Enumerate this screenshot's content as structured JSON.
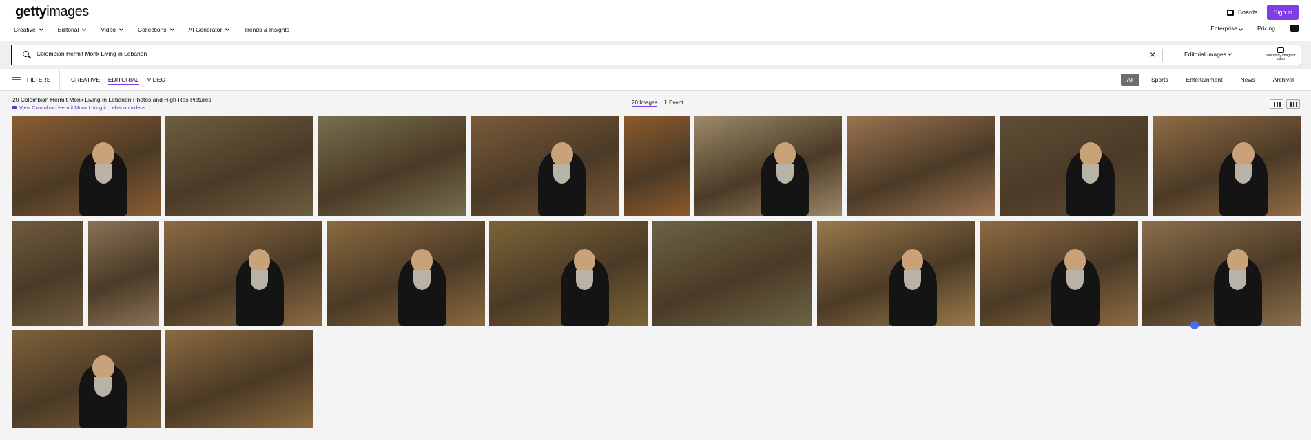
{
  "brand": {
    "logo_bold": "getty",
    "logo_light": "images"
  },
  "header": {
    "boards_label": "Boards",
    "signin_label": "Sign in",
    "nav": [
      {
        "label": "Creative",
        "has_dropdown": true
      },
      {
        "label": "Editorial",
        "has_dropdown": true
      },
      {
        "label": "Video",
        "has_dropdown": true
      },
      {
        "label": "Collections",
        "has_dropdown": true
      },
      {
        "label": "AI Generator",
        "has_dropdown": true
      },
      {
        "label": "Trends & Insights",
        "has_dropdown": false
      }
    ],
    "enterprise_label": "Enterprise",
    "pricing_label": "Pricing"
  },
  "search": {
    "query": "Colombian Hermit Monk Living in Lebanon",
    "type_label": "Editorial Images",
    "search_by_image_label": "Search by image or video"
  },
  "filterbar": {
    "filters_label": "FILTERS",
    "asset_tabs": [
      {
        "label": "CREATIVE",
        "active": false
      },
      {
        "label": "EDITORIAL",
        "active": true
      },
      {
        "label": "VIDEO",
        "active": false
      }
    ],
    "categories": [
      {
        "label": "All",
        "selected": true
      },
      {
        "label": "Sports",
        "selected": false
      },
      {
        "label": "Entertainment",
        "selected": false
      },
      {
        "label": "News",
        "selected": false
      },
      {
        "label": "Archival",
        "selected": false
      }
    ]
  },
  "results": {
    "title": "20 Colombian Hermit Monk Living In Lebanon Photos and High-Res Pictures",
    "video_link": "View Colombian Hermit Monk Living in Lebanon videos",
    "images_count_label": "20 Images",
    "events_count_label": "1 Event"
  },
  "colors": {
    "accent": "#7f3de6",
    "link": "#6b2fd1"
  },
  "images": [
    {
      "desc": "monk holding icon by stone altar",
      "bg": "#8a5d33",
      "person": true
    },
    {
      "desc": "cliff face with shrubs",
      "bg": "#6d5e41",
      "person": false
    },
    {
      "desc": "valley cliffs",
      "bg": "#76704f",
      "person": false
    },
    {
      "desc": "monk on hillside",
      "bg": "#7a5a3a",
      "person": true
    },
    {
      "desc": "rock wall",
      "bg": "#8c5a2c",
      "person": false
    },
    {
      "desc": "monk by stone wall",
      "bg": "#9d8a6a",
      "person": true
    },
    {
      "desc": "rock with niche",
      "bg": "#9a7350",
      "person": false
    },
    {
      "desc": "monk at ledge",
      "bg": "#5f4e36",
      "person": true
    },
    {
      "desc": "monk holding yellow box",
      "bg": "#8f6c45",
      "person": true
    },
    {
      "desc": "narrow stone alley",
      "bg": "#6e5b3f",
      "person": false
    },
    {
      "desc": "hermitage doorway",
      "bg": "#8a7358",
      "person": false
    },
    {
      "desc": "bearded monk portrait",
      "bg": "#8c6b43",
      "person": true
    },
    {
      "desc": "monk with straw hat",
      "bg": "#8a6a40",
      "person": true
    },
    {
      "desc": "monk gardening",
      "bg": "#7b6536",
      "person": true
    },
    {
      "desc": "rocky path with sign",
      "bg": "#6c6446",
      "person": false
    },
    {
      "desc": "monk behind fence",
      "bg": "#9a7a4a",
      "person": true
    },
    {
      "desc": "monk by cross doorway",
      "bg": "#8e6b42",
      "person": true
    },
    {
      "desc": "monk in arched doorway",
      "bg": "#8a6f4c",
      "person": true
    },
    {
      "desc": "monk beside tree",
      "bg": "#7d6039",
      "person": true
    },
    {
      "desc": "stone courtyard with fig tree",
      "bg": "#8b6a3f",
      "person": false
    }
  ]
}
